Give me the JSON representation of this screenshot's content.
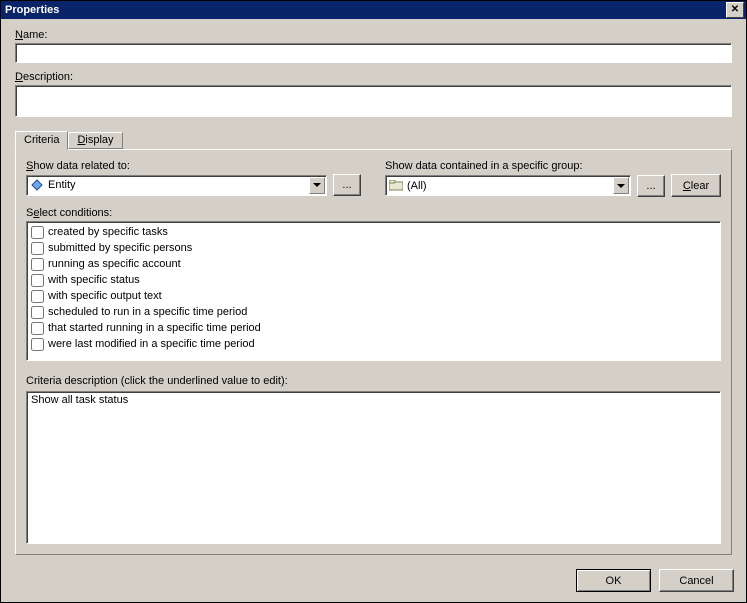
{
  "window": {
    "title": "Properties",
    "close_aria": "Close"
  },
  "fields": {
    "name_label": "Name:",
    "name_value": "",
    "description_label": "Description:",
    "description_value": ""
  },
  "tabs": {
    "criteria": "Criteria",
    "display": "Display",
    "active": "criteria"
  },
  "criteria": {
    "related_label": "Show data related to:",
    "related_value": "Entity",
    "related_browse": "...",
    "group_label": "Show data contained in a specific group:",
    "group_value": "(All)",
    "group_browse": "...",
    "clear_label": "Clear",
    "select_conditions_label": "Select conditions:",
    "conditions": [
      {
        "label": "created by specific tasks",
        "checked": false
      },
      {
        "label": "submitted by specific persons",
        "checked": false
      },
      {
        "label": "running as specific account",
        "checked": false
      },
      {
        "label": "with specific status",
        "checked": false
      },
      {
        "label": "with specific output text",
        "checked": false
      },
      {
        "label": "scheduled to run in a specific time period",
        "checked": false
      },
      {
        "label": "that started running in a specific time period",
        "checked": false
      },
      {
        "label": "were last modified in a specific time period",
        "checked": false
      }
    ],
    "description_label": "Criteria description (click the underlined value to edit):",
    "description_text": "Show all task status"
  },
  "buttons": {
    "ok": "OK",
    "cancel": "Cancel"
  }
}
